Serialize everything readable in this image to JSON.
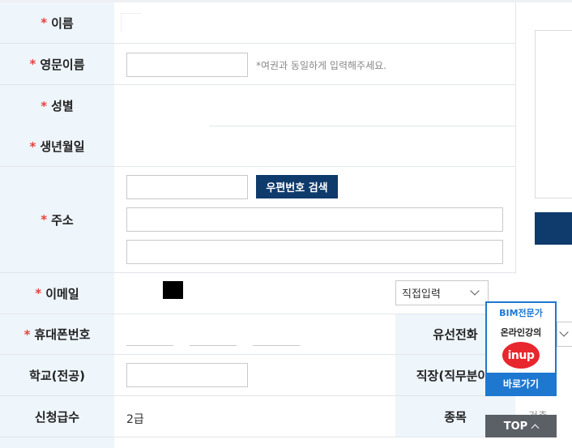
{
  "form": {
    "rows": {
      "name": {
        "label": "이름",
        "required": "*"
      },
      "english_name": {
        "label": "영문이름",
        "required": "*",
        "hint": "*여권과 동일하게 입력해주세요."
      },
      "gender": {
        "label": "성별",
        "required": "*"
      },
      "birth": {
        "label": "생년월일",
        "required": "*"
      },
      "address": {
        "label": "주소",
        "required": "*",
        "zip_button": "우편번호 검색"
      },
      "email": {
        "label": "이메일",
        "required": "*",
        "domain_select": "직접입력"
      },
      "mobile": {
        "label": "휴대폰번호",
        "required": "*",
        "landline_label": "유선전화"
      },
      "school": {
        "label": "학교(전공)",
        "job_label": "직장(직무분야)"
      },
      "grade": {
        "label": "신청급수",
        "value": "2급",
        "category_label": "종목",
        "category_value": "건축"
      }
    }
  },
  "banner": {
    "title": "BIM전문가",
    "subtitle": "온라인강의",
    "logo": "inup",
    "button": "바로가기"
  },
  "top_button": {
    "label": "TOP"
  },
  "colors": {
    "navy": "#0e3a6c",
    "required": "#e8413a",
    "label_bg": "#eef5fb",
    "banner_blue": "#1e78d0",
    "logo_red": "#e8262d"
  }
}
